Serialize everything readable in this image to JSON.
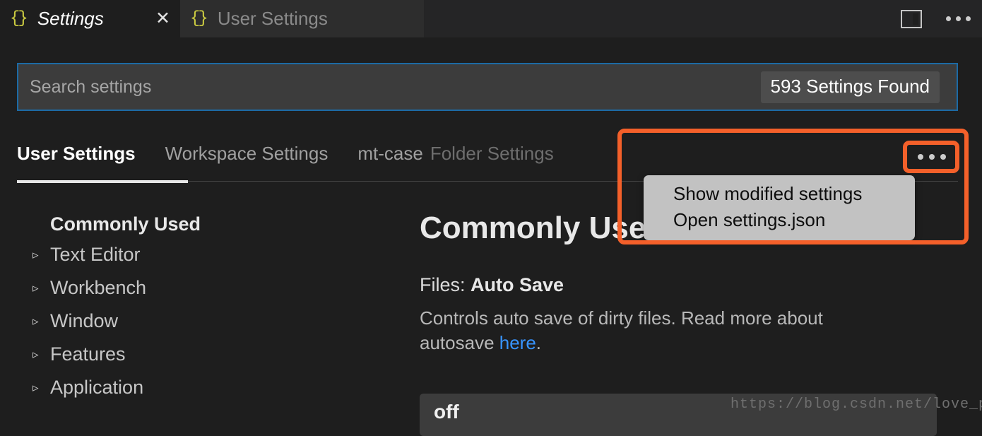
{
  "editor_tabs": [
    {
      "icon": "json-braces-icon",
      "label": "Settings",
      "active": true,
      "close_glyph": "✕"
    },
    {
      "icon": "json-braces-icon",
      "label": "User Settings",
      "active": false
    }
  ],
  "titlebar_actions": {
    "split_editor": "split-editor-icon",
    "more_actions": "more-actions-icon"
  },
  "search": {
    "placeholder": "Search settings",
    "value": "",
    "results_badge": "593 Settings Found"
  },
  "settings_tabs": [
    {
      "label": "User Settings",
      "state": "active"
    },
    {
      "label": "Workspace Settings",
      "state": "muted"
    },
    {
      "label": "mt-case",
      "state": "folder"
    },
    {
      "label": "Folder Settings",
      "state": "folder-dim"
    }
  ],
  "more_menu": {
    "items": [
      "Show modified settings",
      "Open settings.json"
    ]
  },
  "toc": {
    "header": "Commonly Used",
    "items": [
      {
        "label": "Text Editor",
        "chevron": "▹"
      },
      {
        "label": "Workbench",
        "chevron": "▹"
      },
      {
        "label": "Window",
        "chevron": "▹"
      },
      {
        "label": "Features",
        "chevron": "▹"
      },
      {
        "label": "Application",
        "chevron": "▹"
      }
    ]
  },
  "main": {
    "title": "Commonly Used",
    "setting": {
      "category": "Files: ",
      "name": "Auto Save",
      "description_before": "Controls auto save of dirty files. Read more about autosave ",
      "link_text": "here",
      "description_after": ".",
      "value": "off"
    }
  },
  "annotations": {
    "color": "#f4602a",
    "boxes": [
      "more-actions-region",
      "more-actions-button"
    ]
  },
  "watermark": "https://blog.csdn.net/love_parents",
  "colors": {
    "background": "#1e1e1e",
    "tabbar": "#252526",
    "active_tab": "#1e1e1e",
    "inactive_tab": "#2d2d2d",
    "input_bg": "#3c3c3c",
    "focus_border": "#1c6aa5",
    "link": "#3794ff",
    "json_icon": "#cbcb41",
    "menu_bg": "#c2c2c2",
    "annotation": "#f4602a"
  }
}
